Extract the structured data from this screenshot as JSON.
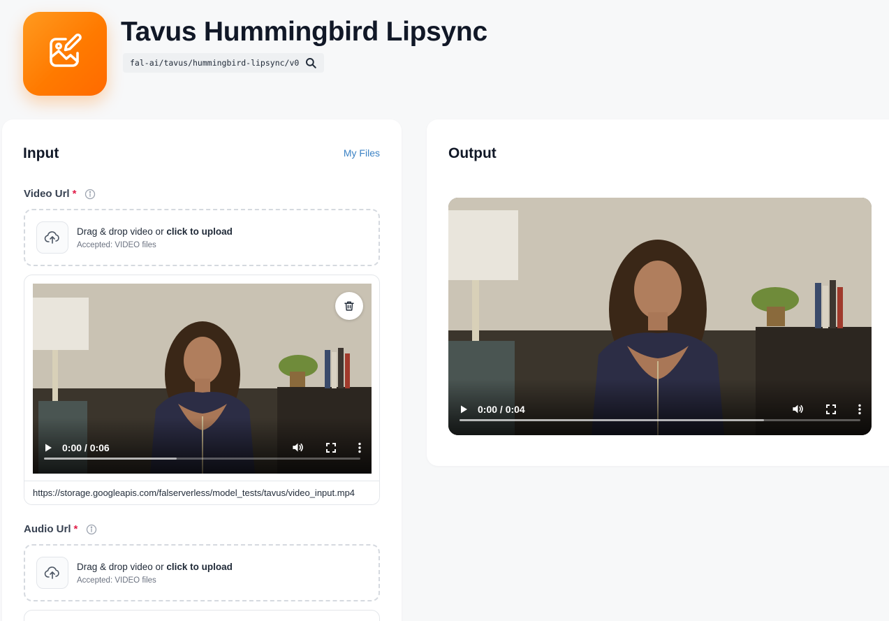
{
  "header": {
    "title": "Tavus Hummingbird Lipsync",
    "model_id": "fal-ai/tavus/hummingbird-lipsync/v0",
    "app_icon": "edit-image-icon",
    "brand_color": "#ff7a00"
  },
  "input": {
    "title": "Input",
    "my_files_label": "My Files",
    "video_url": {
      "label": "Video Url",
      "required_mark": "*",
      "dropzone_prefix": "Drag & drop video or ",
      "dropzone_action": "click to upload",
      "dropzone_sub": "Accepted: VIDEO files",
      "preview": {
        "time": "0:00 / 0:06",
        "progress": 0.42
      },
      "url_value": "https://storage.googleapis.com/falserverless/model_tests/tavus/video_input.mp4"
    },
    "audio_url": {
      "label": "Audio Url",
      "required_mark": "*",
      "dropzone_prefix": "Drag & drop video or ",
      "dropzone_action": "click to upload",
      "dropzone_sub": "Accepted: VIDEO files"
    }
  },
  "output": {
    "title": "Output",
    "video": {
      "time": "0:00 / 0:04",
      "progress": 0.76
    }
  },
  "colors": {
    "link": "#3b82c4",
    "required": "#e11d48"
  }
}
